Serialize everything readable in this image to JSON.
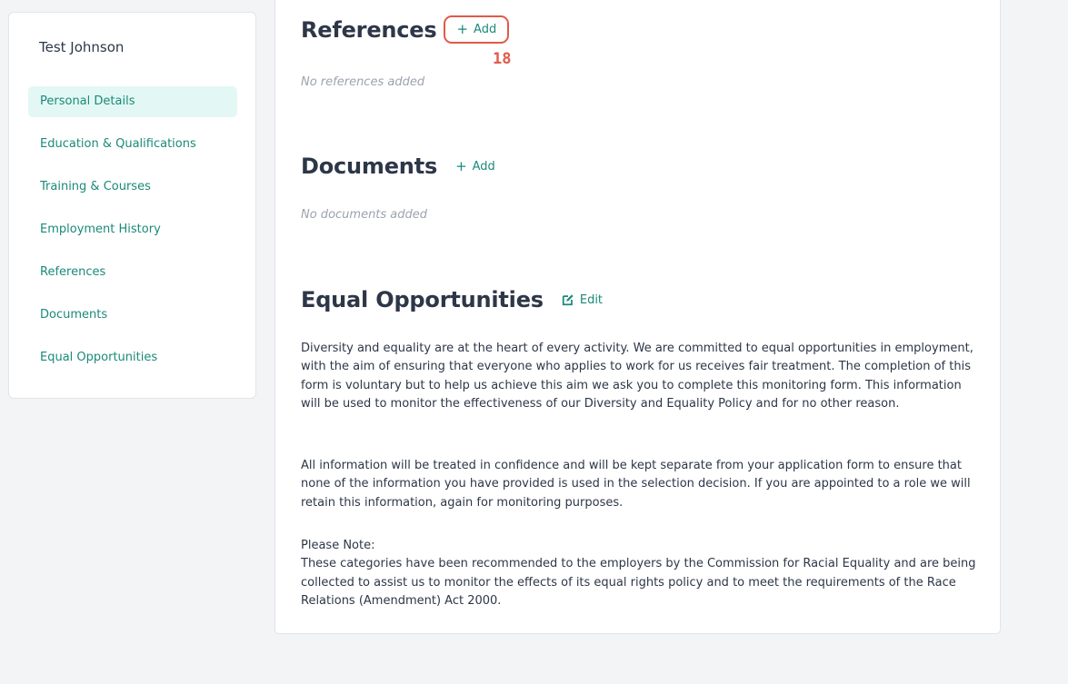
{
  "sidebar": {
    "user_name": "Test Johnson",
    "items": [
      {
        "label": "Personal Details",
        "active": true
      },
      {
        "label": "Education & Qualifications"
      },
      {
        "label": "Training & Courses"
      },
      {
        "label": "Employment History"
      },
      {
        "label": "References"
      },
      {
        "label": "Documents"
      },
      {
        "label": "Equal Opportunities"
      }
    ]
  },
  "references": {
    "title": "References",
    "add_label": "Add",
    "add_icon": "plus-icon",
    "annotation": "18",
    "empty_text": "No references added"
  },
  "documents": {
    "title": "Documents",
    "add_label": "Add",
    "add_icon": "plus-icon",
    "empty_text": "No documents added"
  },
  "equal_opportunities": {
    "title": "Equal Opportunities",
    "edit_label": "Edit",
    "edit_icon": "edit-icon",
    "paragraph_1": "Diversity and equality are at the heart of every activity. We are committed to equal opportunities in employment, with the aim of ensuring that everyone who applies to work for us receives fair treatment. The completion of this form is voluntary but to help us achieve this aim we ask you to complete this monitoring form. This information will be used to monitor the effectiveness of our Diversity and Equality Policy and for no other reason.",
    "paragraph_2": "All information will be treated in confidence and will be kept separate from your application form to ensure that none of the information you have provided is used in the selection decision. If you are appointed to a role we will retain this information, again for monitoring purposes.",
    "note_heading": "Please Note:",
    "note_text": "These categories have been recommended to the employers by the Commission for Racial Equality and are being collected to assist us to monitor the effects of its equal rights policy and to meet the requirements of the Race Relations (Amendment) Act 2000."
  },
  "colors": {
    "accent": "#1a8a7a",
    "active_bg": "#e3f8f4",
    "highlight": "#e05a4a",
    "page_bg": "#f3f4f6"
  }
}
